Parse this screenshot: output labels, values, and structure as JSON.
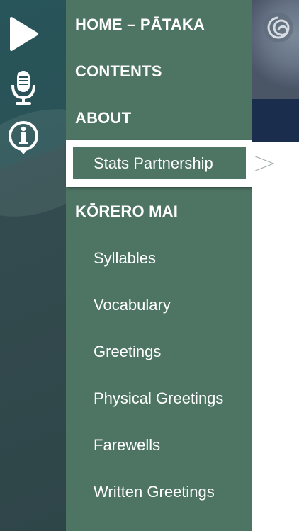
{
  "rail": {
    "buttons": [
      {
        "name": "play",
        "icon": "play-icon"
      },
      {
        "name": "microphone",
        "icon": "microphone-icon"
      },
      {
        "name": "info",
        "icon": "info-icon"
      }
    ]
  },
  "menu": {
    "home_label": "HOME – PĀTAKA",
    "contents_label": "CONTENTS",
    "about_label": "ABOUT",
    "about_items": [
      "Stats Partnership"
    ],
    "korero_label": "KŌRERO MAI",
    "korero_items": [
      "Syllables",
      "Vocabulary",
      "Greetings",
      "Physical Greetings",
      "Farewells",
      "Written Greetings"
    ]
  },
  "colors": {
    "menu_bg": "#4e7564",
    "rail_bg": "#2f4b4f",
    "banner": "#1b2d4c",
    "text": "#ffffff"
  }
}
